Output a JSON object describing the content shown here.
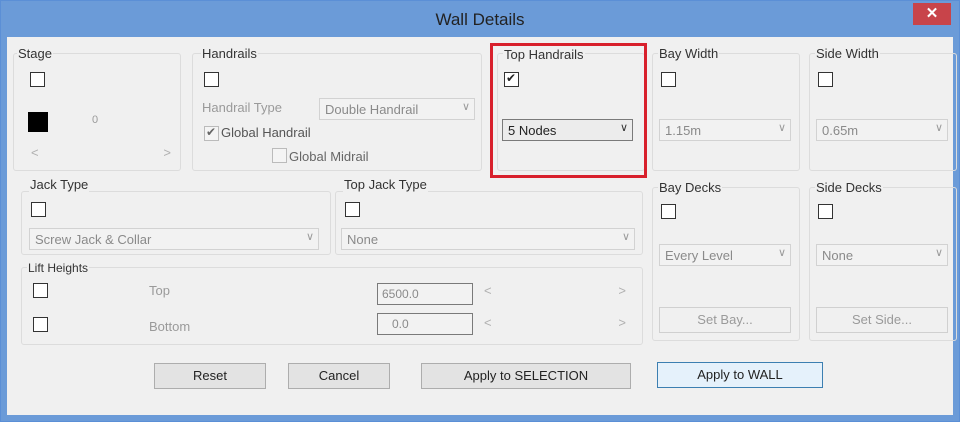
{
  "window": {
    "title": "Wall Details",
    "close_label": "✕"
  },
  "stage": {
    "label": "Stage",
    "checked": false,
    "color": "#000000",
    "value": "0",
    "scroll_left": "<",
    "scroll_right": ">"
  },
  "handrails": {
    "label": "Handrails",
    "checked": false,
    "type_label": "Handrail Type",
    "type_value": "Double Handrail",
    "global_handrail_label": "Global Handrail",
    "global_handrail_checked": true,
    "global_midrail_label": "Global Midrail",
    "global_midrail_checked": false
  },
  "top_handrails": {
    "label": "Top Handrails",
    "checked": true,
    "value": "5 Nodes"
  },
  "bay_width": {
    "label": "Bay Width",
    "checked": false,
    "value": "1.15m"
  },
  "side_width": {
    "label": "Side Width",
    "checked": false,
    "value": "0.65m"
  },
  "jack_type": {
    "label": "Jack Type",
    "checked": false,
    "value": "Screw Jack & Collar"
  },
  "top_jack_type": {
    "label": "Top Jack Type",
    "checked": false,
    "value": "None"
  },
  "lift_heights": {
    "label": "Lift Heights",
    "top_label": "Top",
    "top_value": "6500.0",
    "top_checked": false,
    "bottom_label": "Bottom",
    "bottom_value": "0.0",
    "bottom_checked": false,
    "scroll_left": "<",
    "scroll_right": ">"
  },
  "bay_decks": {
    "label": "Bay Decks",
    "checked": false,
    "value": "Every Level",
    "button": "Set Bay..."
  },
  "side_decks": {
    "label": "Side Decks",
    "checked": false,
    "value": "None",
    "button": "Set Side..."
  },
  "buttons": {
    "reset": "Reset",
    "cancel": "Cancel",
    "apply_selection": "Apply to SELECTION",
    "apply_wall": "Apply to WALL"
  },
  "arrow": "∨",
  "colors": {
    "titlebar": "#6b9bd8",
    "close": "#c8444a",
    "highlight": "#d8202c"
  }
}
